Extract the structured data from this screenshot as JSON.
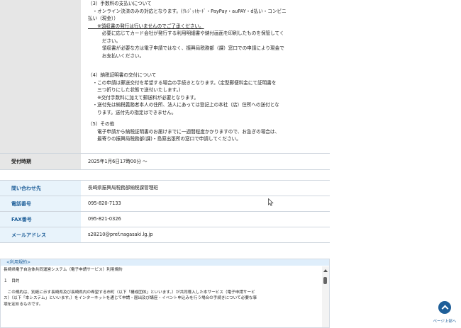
{
  "notes": {
    "l1": "（3）手数料の支払いについて",
    "l2": "　・オンライン決済のみの対応となります。(ｸﾚｼﾞｯﾄｶｰﾄﾞ・PayPay・auPAY・d払い・コンビニ",
    "l3": "払い（現金））",
    "l4": "　　※領収書の発行は行いませんのでご了承ください。",
    "l5": "　　　必要に応じてカード会社が発行する利用明細書や納付画面を印刷したものを保管してく",
    "l6": "　　　ださい。",
    "l7": "　　　領収書が必要な方は電子申請ではなく、振興局税務部（課）窓口での申請により現金で",
    "l8": "　　　お支払いください。",
    "l9": "（4）納税証明書の交付について",
    "l10": "　・この申請は郵送交付を希望する場合の手続きとなります。(定型郵便料金にて証明書を",
    "l11": "　　三つ折りにした状態で送付いたします。)",
    "l12": "　　※交付手数料に加えて郵送料が必要となります。",
    "l13": "　・送付先は納税義務者本人の住所、法人にあっては登記上の本社（店）住所への送付とな",
    "l14": "　　ります。送付先の指定はできません。",
    "l15": "（5）その他",
    "l16": "　　電子申請から納税証明書のお届けまでに一週間程度かかりますので、お急ぎの場合は、",
    "l17": "　　最寄りの振興局税務部(課)・島原出張所の窓口で申請してください。"
  },
  "reception": {
    "label": "受付時期",
    "value": "2025年1月6日17時00分 〜"
  },
  "contact": {
    "inquiry": {
      "label": "問い合わせ先",
      "value": "長崎県振興局税務部納税課管理班"
    },
    "phone": {
      "label": "電話番号",
      "value": "095-820-7133"
    },
    "fax": {
      "label": "FAX番号",
      "value": "095-821-0326"
    },
    "email": {
      "label": "メールアドレス",
      "value": "s28210@pref.nagasaki.lg.jp"
    }
  },
  "terms": {
    "header": "<利用規約>",
    "title": "長崎県電子自治体共同運営システム（電子申請サービス）利用規約",
    "section": "１　目的",
    "body1": "　この規約は、別紙に示す長崎県及び長崎県内の希望する市町（以下「構成団体」といいます。）が共同導入した本サービス（電子申請サービ",
    "body2": "ス）（以下「本システム」といいます。）をインターネットを通じて申請・届出及び講座・イベント申込みを行う場合の手続きについて必要な事",
    "body3": "項を定めるものです。"
  },
  "page_top": {
    "label": "ページ上部へ"
  }
}
